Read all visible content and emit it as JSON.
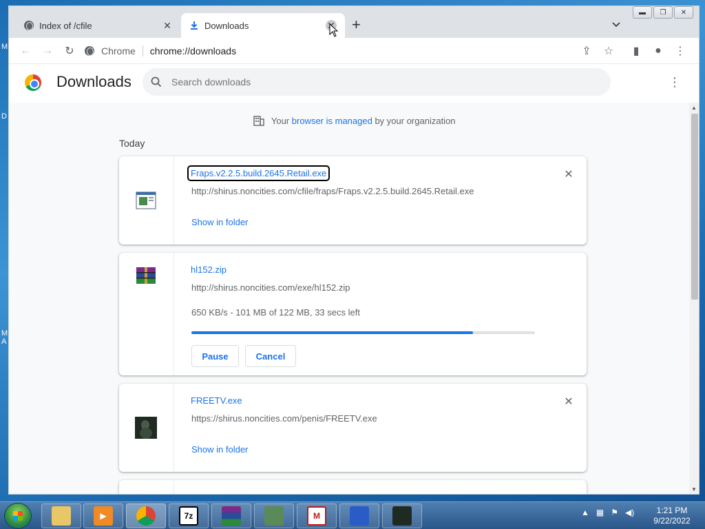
{
  "browser": {
    "tabs": [
      {
        "title": "Index of /cfile",
        "active": false
      },
      {
        "title": "Downloads",
        "active": true
      }
    ],
    "omnibox": {
      "site_label": "Chrome",
      "url": "chrome://downloads"
    }
  },
  "downloads_page": {
    "title": "Downloads",
    "search_placeholder": "Search downloads",
    "managed_notice": {
      "prefix": "Your",
      "link": "browser is managed",
      "suffix": "by your organization"
    },
    "section_label": "Today",
    "items": [
      {
        "file_name": "Fraps.v2.2.5.build.2645.Retail.exe",
        "url": "http://shirus.noncities.com/cfile/fraps/Fraps.v2.2.5.build.2645.Retail.exe",
        "action": "Show in folder",
        "icon": "exe-window-icon"
      },
      {
        "file_name": "hl152.zip",
        "url": "http://shirus.noncities.com/exe/hl152.zip",
        "status": "650 KB/s - 101 MB of 122 MB, 33 secs left",
        "progress": 0.82,
        "pause_label": "Pause",
        "cancel_label": "Cancel",
        "icon": "winrar-archive-icon"
      },
      {
        "file_name": "FREETV.exe",
        "url": "https://shirus.noncities.com/penis/FREETV.exe",
        "action": "Show in folder",
        "icon": "freetv-thumbnail-icon"
      }
    ]
  },
  "taskbar": {
    "clock_time": "1:21 PM",
    "clock_date": "9/22/2022",
    "pinned": [
      "explorer-icon",
      "media-player-icon",
      "chrome-icon",
      "7zip-icon",
      "winrar-icon",
      "monitor-app-icon",
      "m-app-icon",
      "blue-app-icon",
      "freetv-app-icon"
    ]
  },
  "colors": {
    "link_blue": "#1a73e8",
    "tab_strip": "#dee1e6",
    "page_bg": "#f8f9fa"
  }
}
